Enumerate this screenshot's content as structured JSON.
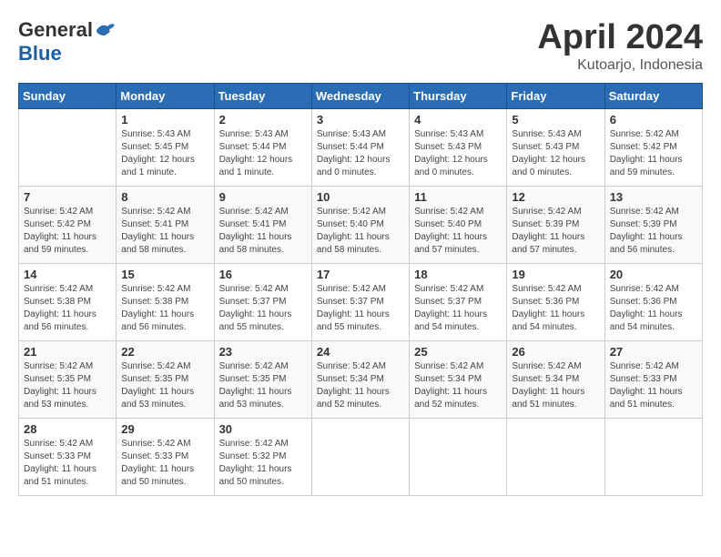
{
  "header": {
    "logo_general": "General",
    "logo_blue": "Blue",
    "month_title": "April 2024",
    "location": "Kutoarjo, Indonesia"
  },
  "calendar": {
    "columns": [
      "Sunday",
      "Monday",
      "Tuesday",
      "Wednesday",
      "Thursday",
      "Friday",
      "Saturday"
    ],
    "rows": [
      [
        {
          "day": "",
          "info": ""
        },
        {
          "day": "1",
          "info": "Sunrise: 5:43 AM\nSunset: 5:45 PM\nDaylight: 12 hours\nand 1 minute."
        },
        {
          "day": "2",
          "info": "Sunrise: 5:43 AM\nSunset: 5:44 PM\nDaylight: 12 hours\nand 1 minute."
        },
        {
          "day": "3",
          "info": "Sunrise: 5:43 AM\nSunset: 5:44 PM\nDaylight: 12 hours\nand 0 minutes."
        },
        {
          "day": "4",
          "info": "Sunrise: 5:43 AM\nSunset: 5:43 PM\nDaylight: 12 hours\nand 0 minutes."
        },
        {
          "day": "5",
          "info": "Sunrise: 5:43 AM\nSunset: 5:43 PM\nDaylight: 12 hours\nand 0 minutes."
        },
        {
          "day": "6",
          "info": "Sunrise: 5:42 AM\nSunset: 5:42 PM\nDaylight: 11 hours\nand 59 minutes."
        }
      ],
      [
        {
          "day": "7",
          "info": "Sunrise: 5:42 AM\nSunset: 5:42 PM\nDaylight: 11 hours\nand 59 minutes."
        },
        {
          "day": "8",
          "info": "Sunrise: 5:42 AM\nSunset: 5:41 PM\nDaylight: 11 hours\nand 58 minutes."
        },
        {
          "day": "9",
          "info": "Sunrise: 5:42 AM\nSunset: 5:41 PM\nDaylight: 11 hours\nand 58 minutes."
        },
        {
          "day": "10",
          "info": "Sunrise: 5:42 AM\nSunset: 5:40 PM\nDaylight: 11 hours\nand 58 minutes."
        },
        {
          "day": "11",
          "info": "Sunrise: 5:42 AM\nSunset: 5:40 PM\nDaylight: 11 hours\nand 57 minutes."
        },
        {
          "day": "12",
          "info": "Sunrise: 5:42 AM\nSunset: 5:39 PM\nDaylight: 11 hours\nand 57 minutes."
        },
        {
          "day": "13",
          "info": "Sunrise: 5:42 AM\nSunset: 5:39 PM\nDaylight: 11 hours\nand 56 minutes."
        }
      ],
      [
        {
          "day": "14",
          "info": "Sunrise: 5:42 AM\nSunset: 5:38 PM\nDaylight: 11 hours\nand 56 minutes."
        },
        {
          "day": "15",
          "info": "Sunrise: 5:42 AM\nSunset: 5:38 PM\nDaylight: 11 hours\nand 56 minutes."
        },
        {
          "day": "16",
          "info": "Sunrise: 5:42 AM\nSunset: 5:37 PM\nDaylight: 11 hours\nand 55 minutes."
        },
        {
          "day": "17",
          "info": "Sunrise: 5:42 AM\nSunset: 5:37 PM\nDaylight: 11 hours\nand 55 minutes."
        },
        {
          "day": "18",
          "info": "Sunrise: 5:42 AM\nSunset: 5:37 PM\nDaylight: 11 hours\nand 54 minutes."
        },
        {
          "day": "19",
          "info": "Sunrise: 5:42 AM\nSunset: 5:36 PM\nDaylight: 11 hours\nand 54 minutes."
        },
        {
          "day": "20",
          "info": "Sunrise: 5:42 AM\nSunset: 5:36 PM\nDaylight: 11 hours\nand 54 minutes."
        }
      ],
      [
        {
          "day": "21",
          "info": "Sunrise: 5:42 AM\nSunset: 5:35 PM\nDaylight: 11 hours\nand 53 minutes."
        },
        {
          "day": "22",
          "info": "Sunrise: 5:42 AM\nSunset: 5:35 PM\nDaylight: 11 hours\nand 53 minutes."
        },
        {
          "day": "23",
          "info": "Sunrise: 5:42 AM\nSunset: 5:35 PM\nDaylight: 11 hours\nand 53 minutes."
        },
        {
          "day": "24",
          "info": "Sunrise: 5:42 AM\nSunset: 5:34 PM\nDaylight: 11 hours\nand 52 minutes."
        },
        {
          "day": "25",
          "info": "Sunrise: 5:42 AM\nSunset: 5:34 PM\nDaylight: 11 hours\nand 52 minutes."
        },
        {
          "day": "26",
          "info": "Sunrise: 5:42 AM\nSunset: 5:34 PM\nDaylight: 11 hours\nand 51 minutes."
        },
        {
          "day": "27",
          "info": "Sunrise: 5:42 AM\nSunset: 5:33 PM\nDaylight: 11 hours\nand 51 minutes."
        }
      ],
      [
        {
          "day": "28",
          "info": "Sunrise: 5:42 AM\nSunset: 5:33 PM\nDaylight: 11 hours\nand 51 minutes."
        },
        {
          "day": "29",
          "info": "Sunrise: 5:42 AM\nSunset: 5:33 PM\nDaylight: 11 hours\nand 50 minutes."
        },
        {
          "day": "30",
          "info": "Sunrise: 5:42 AM\nSunset: 5:32 PM\nDaylight: 11 hours\nand 50 minutes."
        },
        {
          "day": "",
          "info": ""
        },
        {
          "day": "",
          "info": ""
        },
        {
          "day": "",
          "info": ""
        },
        {
          "day": "",
          "info": ""
        }
      ]
    ]
  }
}
